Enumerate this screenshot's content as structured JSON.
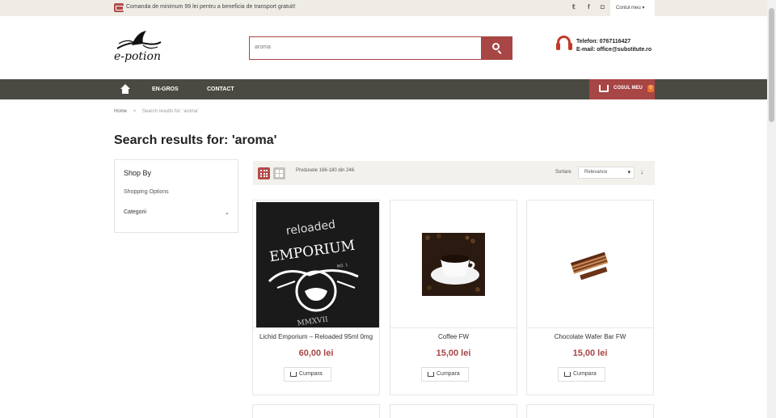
{
  "topbar": {
    "promo": "Comanda de minimum 99 lei pentru a beneficia de transport gratuit!",
    "social": {
      "twitter": "𝕥",
      "facebook": "f",
      "instagram": "◘"
    },
    "account_label": "Contul meu ▾"
  },
  "header": {
    "logo_text": "e-potion",
    "search_value": "aroma",
    "phone": "Telefon: 0767116427",
    "email": "E-mail: office@substitute.ro"
  },
  "nav": {
    "items": [
      {
        "label": "EN-GROS"
      },
      {
        "label": "CONTACT"
      }
    ],
    "cart_label": "COSUL MEU",
    "cart_count": "0"
  },
  "breadcrumb": {
    "home": "Home",
    "sep": ">",
    "current": "Search results for: 'aroma'"
  },
  "page_title": "Search results for: 'aroma'",
  "sidebar": {
    "title": "Shop By",
    "subtitle": "Shopping Options",
    "filter_label": "Categorii",
    "caret": "⌄"
  },
  "toolbar": {
    "count_text": "Produsele 166-180 din 246",
    "sort_label": "Sortare",
    "sort_value": "Relevance",
    "sort_dir": "↓"
  },
  "products": [
    {
      "name": "Lichid Emporium – Reloaded 95ml 0mg",
      "price": "60,00 lei",
      "button": "Cumpara",
      "img_top": "reloaded",
      "img_main": "EMPORIUM",
      "img_no": "NO. 1",
      "img_year": "MMXVII"
    },
    {
      "name": "Coffee FW",
      "price": "15,00 lei",
      "button": "Cumpara"
    },
    {
      "name": "Chocolate Wafer Bar FW",
      "price": "15,00 lei",
      "button": "Cumpara"
    }
  ],
  "colors": {
    "accent": "#a84545",
    "nav_bg": "#4b4a42",
    "topbar_bg": "#efece6",
    "cart_badge": "#e8762b"
  }
}
